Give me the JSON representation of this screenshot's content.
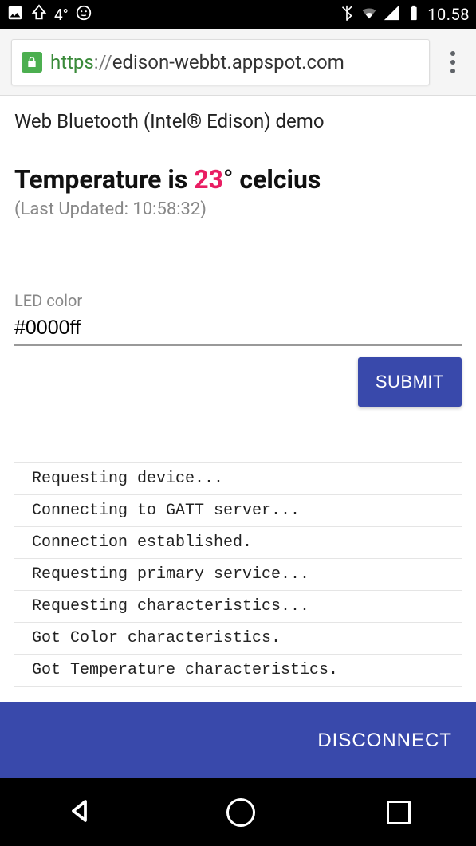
{
  "status": {
    "temp": "4°",
    "clock": "10.58"
  },
  "browser": {
    "scheme": "https",
    "sep": "://",
    "host": "edison-webbt.appspot.com"
  },
  "page": {
    "subtitle": "Web Bluetooth (Intel® Edison) demo",
    "temp_prefix": "Temperature is ",
    "temp_value": "23",
    "temp_suffix": "° celcius",
    "updated_prefix": "(Last Updated: ",
    "updated_time": "10:58:32",
    "updated_suffix": ")"
  },
  "field": {
    "label": "LED color",
    "value": "#0000ff"
  },
  "buttons": {
    "submit": "SUBMIT",
    "disconnect": "DISCONNECT"
  },
  "log": [
    "Requesting device...",
    "Connecting to GATT server...",
    "Connection established.",
    "Requesting primary service...",
    "Requesting characteristics...",
    "Got Color characteristics.",
    "Got Temperature characteristics."
  ]
}
